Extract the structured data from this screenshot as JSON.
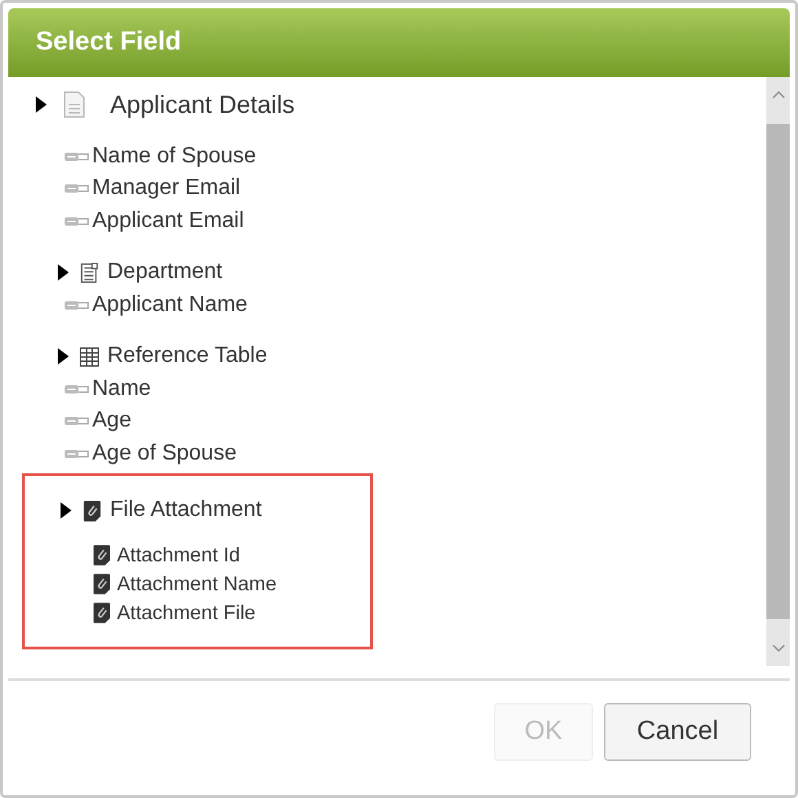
{
  "dialog": {
    "title": "Select Field"
  },
  "tree": {
    "label": "Applicant Details",
    "kind": "section",
    "children": [
      {
        "label": "Name of Spouse",
        "kind": "field"
      },
      {
        "label": "Manager Email",
        "kind": "field"
      },
      {
        "label": "Applicant Email",
        "kind": "field"
      },
      {
        "label": "Department",
        "kind": "form"
      },
      {
        "label": "Applicant Name",
        "kind": "field"
      },
      {
        "label": "Reference Table",
        "kind": "table"
      },
      {
        "label": "Name",
        "kind": "field"
      },
      {
        "label": "Age",
        "kind": "field"
      },
      {
        "label": "Age of Spouse",
        "kind": "field"
      },
      {
        "label": "File Attachment",
        "kind": "attachment",
        "highlighted": true,
        "children": [
          {
            "label": "Attachment Id",
            "kind": "attachment-field"
          },
          {
            "label": "Attachment Name",
            "kind": "attachment-field"
          },
          {
            "label": "Attachment File",
            "kind": "attachment-field"
          }
        ]
      }
    ]
  },
  "buttons": [
    {
      "label": "OK",
      "disabled": true
    },
    {
      "label": "Cancel",
      "disabled": false
    }
  ]
}
